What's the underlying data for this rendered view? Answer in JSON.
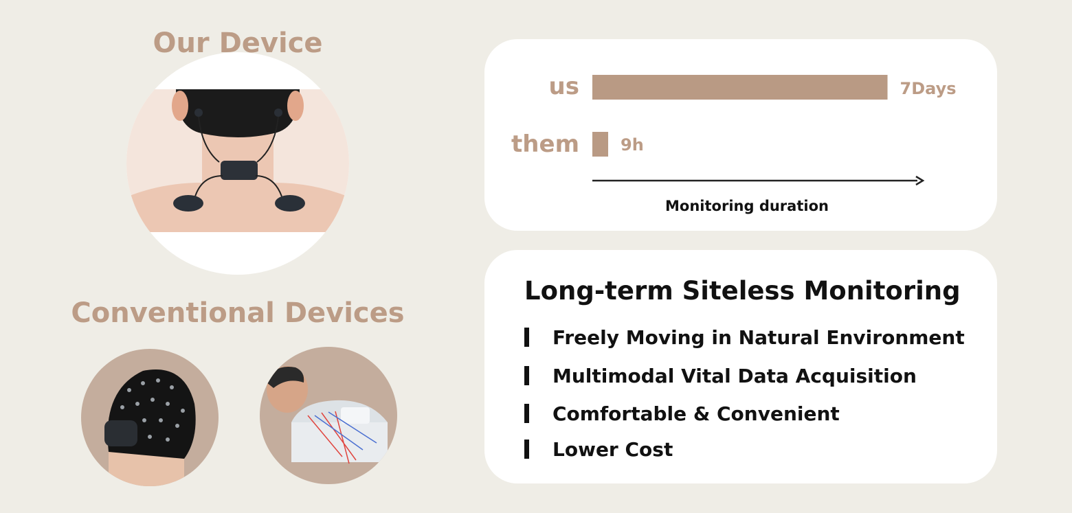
{
  "left": {
    "our_device_title": "Our Device",
    "conventional_title": "Conventional Devices"
  },
  "features": {
    "title": "Long-term Siteless Monitoring",
    "items": [
      "Freely Moving in Natural Environment",
      "Multimodal Vital Data Acquisition",
      "Comfortable & Convenient",
      "Lower Cost"
    ]
  },
  "colors": {
    "background": "#efede6",
    "accent_tan": "#bc9c86",
    "bar": "#b99a84",
    "circle_fill": "#c4ad9d",
    "text_dark": "#111111"
  },
  "chart_data": {
    "type": "bar",
    "orientation": "horizontal",
    "categories": [
      "us",
      "them"
    ],
    "values": [
      168,
      9
    ],
    "value_unit": "hours",
    "value_labels": [
      "7Days",
      "9h"
    ],
    "xlabel": "Monitoring duration",
    "ylabel": "",
    "xlim": [
      0,
      185
    ],
    "grid": false,
    "legend": "none"
  }
}
